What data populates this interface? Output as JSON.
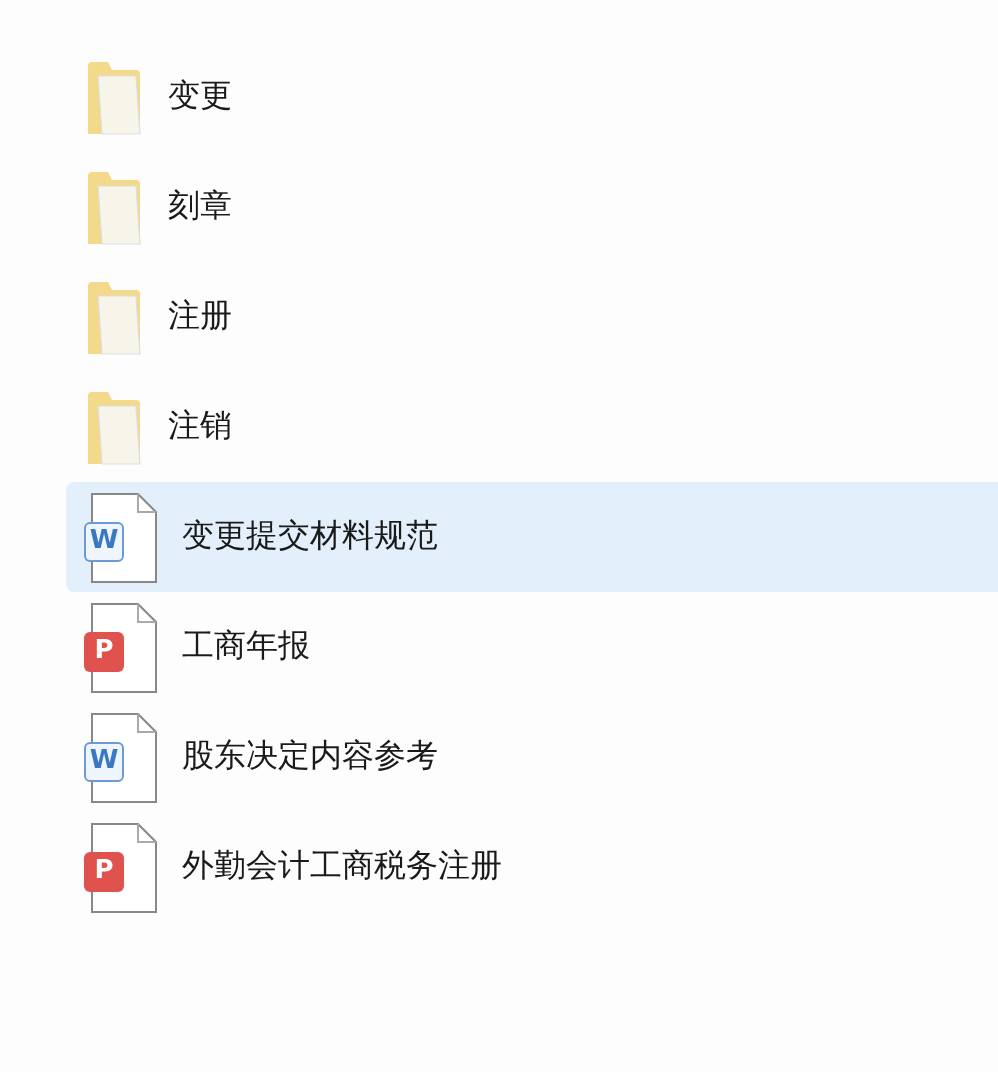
{
  "files": [
    {
      "kind": "folder",
      "name": "变更",
      "selected": false
    },
    {
      "kind": "folder",
      "name": "刻章",
      "selected": false
    },
    {
      "kind": "folder",
      "name": "注册",
      "selected": false
    },
    {
      "kind": "folder",
      "name": "注销",
      "selected": false
    },
    {
      "kind": "word",
      "name": "变更提交材料规范",
      "badge": "W",
      "selected": true
    },
    {
      "kind": "pdf",
      "name": "工商年报",
      "badge": "P",
      "selected": false
    },
    {
      "kind": "word",
      "name": "股东决定内容参考",
      "badge": "W",
      "selected": false
    },
    {
      "kind": "pdf",
      "name": "外勤会计工商税务注册",
      "badge": "P",
      "selected": false
    }
  ]
}
